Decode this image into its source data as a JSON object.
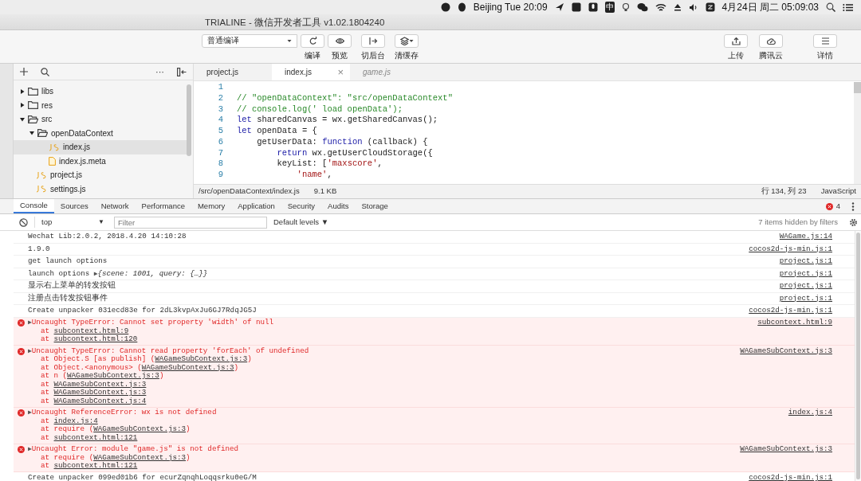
{
  "menubar": {
    "clock": "Beijing Tue 20:09",
    "input_method": "中",
    "date": "4月24日 周二  05:09:03"
  },
  "window": {
    "title": "TRIALINE - 微信开发者工具 v1.02.1804240"
  },
  "toolbar": {
    "compile_mode": "普通编译",
    "buttons": [
      {
        "label": "编译",
        "kind": "refresh"
      },
      {
        "label": "预览",
        "kind": "eye"
      },
      {
        "label": "切后台",
        "kind": "background"
      },
      {
        "label": "清缓存",
        "kind": "cache"
      }
    ],
    "right_buttons": [
      {
        "label": "上传",
        "kind": "upload"
      },
      {
        "label": "腾讯云",
        "kind": "cloud"
      },
      {
        "label": "详情",
        "kind": "menu"
      }
    ]
  },
  "sidebar": {
    "more": "···",
    "tree": [
      {
        "label": "libs",
        "kind": "folder",
        "expanded": false,
        "selected": false
      },
      {
        "label": "res",
        "kind": "folder",
        "expanded": false,
        "selected": false
      },
      {
        "label": "src",
        "kind": "folder",
        "expanded": true,
        "selected": false,
        "children": [
          {
            "label": "openDataContext",
            "kind": "folder",
            "expanded": true,
            "selected": false,
            "children": [
              {
                "label": "index.js",
                "kind": "js",
                "selected": true
              },
              {
                "label": "index.js.meta",
                "kind": "meta",
                "selected": false
              }
            ]
          },
          {
            "label": "project.js",
            "kind": "js",
            "selected": false
          },
          {
            "label": "settings.js",
            "kind": "js",
            "selected": false
          }
        ]
      }
    ]
  },
  "editor": {
    "tabs": [
      {
        "label": "project.js",
        "selected": false,
        "preview": false
      },
      {
        "label": "index.js",
        "selected": true,
        "preview": false,
        "close": "×"
      },
      {
        "label": "game.js",
        "selected": false,
        "preview": true
      }
    ],
    "lines": [
      {
        "number": "1"
      },
      {
        "number": "2",
        "tokens": [
          {
            "text": "// \"openDataContext\": \"src/openDataContext\"",
            "kind": "comment"
          }
        ]
      },
      {
        "number": "3",
        "tokens": [
          {
            "text": "// console.log(' load openData');",
            "kind": "comment"
          }
        ]
      },
      {
        "number": "4",
        "tokens": [
          {
            "text": "let",
            "kind": "keyword"
          },
          {
            "text": " sharedCanvas = wx.getSharedCanvas();",
            "kind": "plain"
          }
        ]
      },
      {
        "number": "5",
        "tokens": [
          {
            "text": "let",
            "kind": "keyword"
          },
          {
            "text": " openData = {",
            "kind": "plain"
          }
        ]
      },
      {
        "number": "6",
        "tokens": [
          {
            "text": "    getUserData: ",
            "kind": "plain"
          },
          {
            "text": "function",
            "kind": "keyword"
          },
          {
            "text": " (callback) {",
            "kind": "plain"
          }
        ]
      },
      {
        "number": "7",
        "tokens": [
          {
            "text": "        return",
            "kind": "keyword"
          },
          {
            "text": " wx.getUserCloudStorage({",
            "kind": "plain"
          }
        ]
      },
      {
        "number": "8",
        "tokens": [
          {
            "text": "        keyList: [",
            "kind": "plain"
          },
          {
            "text": "'maxscore'",
            "kind": "string"
          },
          {
            "text": ",",
            "kind": "plain"
          }
        ]
      },
      {
        "number": "9",
        "tokens": [
          {
            "text": "            'name'",
            "kind": "string"
          },
          {
            "text": ",",
            "kind": "plain"
          }
        ]
      }
    ],
    "status": {
      "path": "/src/openDataContext/index.js",
      "size": "9.1 KB",
      "position": "行 134, 列 23",
      "language": "JavaScript"
    }
  },
  "devtools": {
    "tabs": [
      {
        "label": "Console",
        "selected": true
      },
      {
        "label": "Sources",
        "selected": false
      },
      {
        "label": "Network",
        "selected": false
      },
      {
        "label": "Performance",
        "selected": false
      },
      {
        "label": "Memory",
        "selected": false
      },
      {
        "label": "Application",
        "selected": false
      },
      {
        "label": "Security",
        "selected": false
      },
      {
        "label": "Audits",
        "selected": false
      },
      {
        "label": "Storage",
        "selected": false
      }
    ],
    "error_count": "4",
    "context": "top",
    "context_caret": "▼",
    "filter": {
      "placeholder": "Filter"
    },
    "levels": "Default levels ▼",
    "hidden": "7 items hidden by filters"
  },
  "console": [
    {
      "kind": "log",
      "text": "Wechat Lib:2.0.2, 2018.4.20 14:10:28",
      "source": "WAGame.js:14"
    },
    {
      "kind": "log",
      "text": "1.9.0",
      "source": "cocos2d-js-min.js:1"
    },
    {
      "kind": "log",
      "text": "get launch options",
      "source": "project.js:1"
    },
    {
      "kind": "log",
      "text": "launch options",
      "expander": "▶",
      "preview": "{scene: 1001, query: {…}}",
      "source": "project.js:1"
    },
    {
      "kind": "log",
      "text": "显示右上菜单的转发按钮",
      "source": "project.js:1"
    },
    {
      "kind": "log",
      "text": "注册点击转发按钮事件",
      "source": "project.js:1"
    },
    {
      "kind": "log",
      "text": "Create unpacker 031ecd83e for 2dL3kvpAxJu6GJ7RdqJG5J",
      "source": "cocos2d-js-min.js:1"
    },
    {
      "kind": "error",
      "expander": "▶",
      "text": "Uncaught TypeError: Cannot set property 'width' of null",
      "source": "subcontext.html:9",
      "stack": [
        {
          "before": "at ",
          "link": "subcontext.html:9"
        },
        {
          "before": "at ",
          "link": "subcontext.html:120"
        }
      ]
    },
    {
      "kind": "error",
      "expander": "▶",
      "text": "Uncaught TypeError: Cannot read property 'forEach' of undefined",
      "source": "WAGameSubContext.js:3",
      "stack": [
        {
          "before": "at Object.S [as publish] (",
          "link": "WAGameSubContext.js:3",
          "after": ")"
        },
        {
          "before": "at Object.<anonymous> (",
          "link": "WAGameSubContext.js:3",
          "after": ")"
        },
        {
          "before": "at n (",
          "link": "WAGameSubContext.js:3",
          "after": ")"
        },
        {
          "before": "at ",
          "link": "WAGameSubContext.js:3"
        },
        {
          "before": "at ",
          "link": "WAGameSubContext.js:3"
        },
        {
          "before": "at ",
          "link": "WAGameSubContext.js:4"
        }
      ]
    },
    {
      "kind": "error",
      "expander": "▶",
      "text": "Uncaught ReferenceError: wx is not defined",
      "source": "index.js:4",
      "stack": [
        {
          "before": "at ",
          "link": "index.js:4"
        },
        {
          "before": "at require (",
          "link": "WAGameSubContext.js:3",
          "after": ")"
        },
        {
          "before": "at ",
          "link": "subcontext.html:121"
        }
      ]
    },
    {
      "kind": "error",
      "expander": "▶",
      "text": "Uncaught Error: module \"game.js\" is not defined",
      "source": "WAGameSubContext.js:3",
      "stack": [
        {
          "before": "at require (",
          "link": "WAGameSubContext.js:3",
          "after": ")"
        },
        {
          "before": "at ",
          "link": "subcontext.html:121"
        }
      ]
    },
    {
      "kind": "log",
      "text": "Create unpacker 099ed01b6 for ecurZqnqhLoqqsrku0eG/M",
      "source": "cocos2d-js-min.js:1"
    }
  ]
}
